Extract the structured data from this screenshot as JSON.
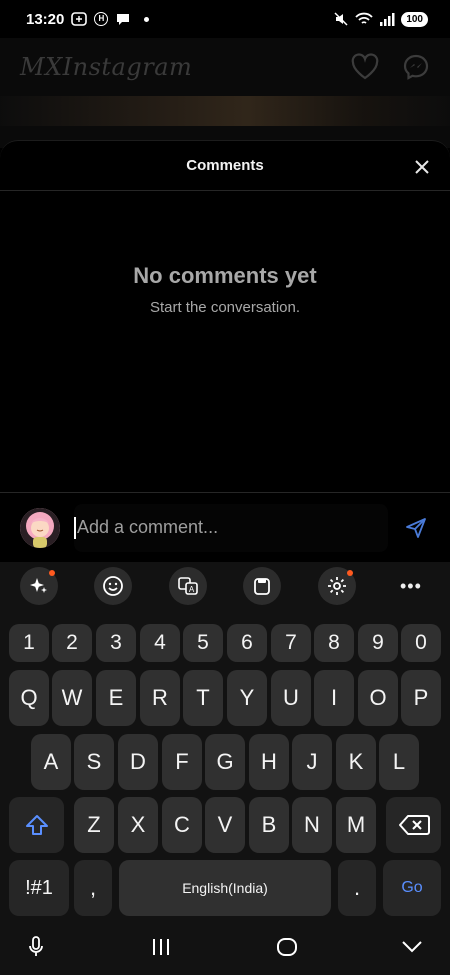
{
  "status_bar": {
    "time": "13:20",
    "battery": "100",
    "icons": [
      "sync-icon",
      "h-badge-icon",
      "chat-bubble-icon",
      "notification-dot",
      "mute-icon",
      "wifi-icon",
      "signal-icon",
      "battery-icon"
    ]
  },
  "background_app": {
    "logo": "MXInstagram",
    "icons": [
      "heart-icon",
      "messenger-icon"
    ]
  },
  "comments": {
    "title": "Comments",
    "close_icon": "close-icon",
    "empty_title": "No comments yet",
    "empty_subtitle": "Start the conversation."
  },
  "comment_input": {
    "placeholder": "Add a comment...",
    "send_icon": "send-icon"
  },
  "keyboard": {
    "toolbar": [
      "sparkle-icon",
      "emoji-icon",
      "translate-icon",
      "clipboard-icon",
      "settings-icon",
      "more-icon"
    ],
    "more_label": "•••",
    "number_row": [
      "1",
      "2",
      "3",
      "4",
      "5",
      "6",
      "7",
      "8",
      "9",
      "0"
    ],
    "row1": [
      "Q",
      "W",
      "E",
      "R",
      "T",
      "Y",
      "U",
      "I",
      "O",
      "P"
    ],
    "row2": [
      "A",
      "S",
      "D",
      "F",
      "G",
      "H",
      "J",
      "K",
      "L"
    ],
    "row3": [
      "Z",
      "X",
      "C",
      "V",
      "B",
      "N",
      "M"
    ],
    "symbols_label": "!#1",
    "comma_label": ",",
    "space_label": "English(India)",
    "period_label": ".",
    "go_label": "Go",
    "accent_color": "#5a8fff"
  },
  "nav_bar": [
    "microphone-icon",
    "recent-apps-icon",
    "home-icon",
    "back-icon"
  ]
}
